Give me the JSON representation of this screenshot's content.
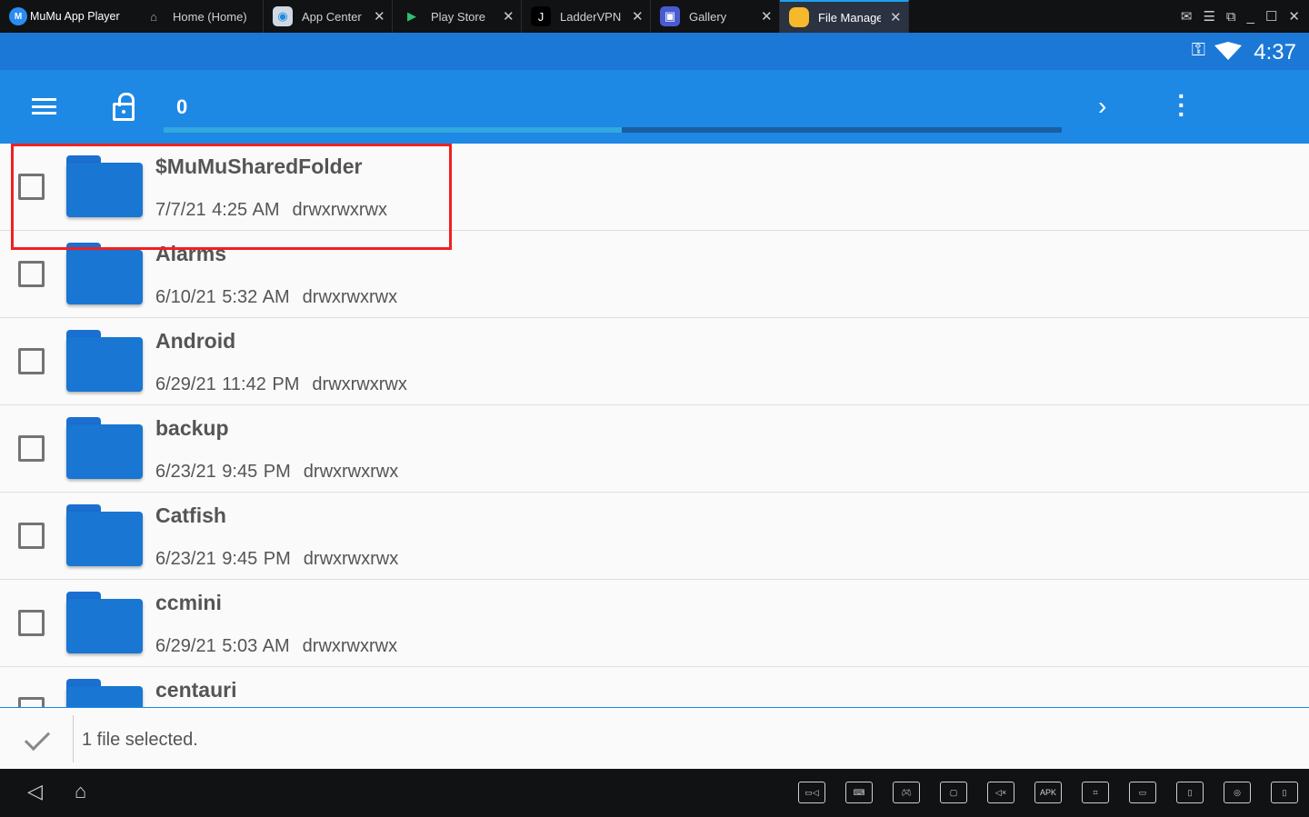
{
  "titlebar": {
    "app_name": "MuMu App Player",
    "tabs": [
      {
        "label": "Home (Home)",
        "icon": "home-icon",
        "closable": false,
        "active": false
      },
      {
        "label": "App Center",
        "icon": "app-center-icon",
        "closable": true,
        "active": false
      },
      {
        "label": "Play Store",
        "icon": "play-store-icon",
        "closable": true,
        "active": false
      },
      {
        "label": "LadderVPN",
        "icon": "laddervpn-icon",
        "closable": true,
        "active": false
      },
      {
        "label": "Gallery",
        "icon": "gallery-icon",
        "closable": true,
        "active": false
      },
      {
        "label": "File Manager",
        "icon": "file-manager-icon",
        "closable": true,
        "active": true
      }
    ]
  },
  "statusbar": {
    "time": "4:37",
    "icons": [
      "vpn-key-icon",
      "wifi-icon"
    ]
  },
  "toolbar": {
    "count": "0",
    "progress_percent": 51,
    "color": "#1e88e5"
  },
  "files": [
    {
      "name": "$MuMuSharedFolder",
      "date": "7/7/21 4:25 AM",
      "perms": "drwxrwxrwx",
      "checked": false,
      "highlighted": true
    },
    {
      "name": "Alarms",
      "date": "6/10/21 5:32 AM",
      "perms": "drwxrwxrwx",
      "checked": false
    },
    {
      "name": "Android",
      "date": "6/29/21 11:42 PM",
      "perms": "drwxrwxrwx",
      "checked": false
    },
    {
      "name": "backup",
      "date": "6/23/21 9:45 PM",
      "perms": "drwxrwxrwx",
      "checked": false
    },
    {
      "name": "Catfish",
      "date": "6/23/21 9:45 PM",
      "perms": "drwxrwxrwx",
      "checked": false
    },
    {
      "name": "ccmini",
      "date": "6/29/21 5:03 AM",
      "perms": "drwxrwxrwx",
      "checked": false
    },
    {
      "name": "centauri",
      "date": "",
      "perms": "",
      "checked": false
    }
  ],
  "footer": {
    "selection_text": "1 file selected."
  },
  "navbar": {
    "tools": [
      "video-record-icon",
      "keyboard-icon",
      "gamepad-icon",
      "screenshot-icon",
      "mute-icon",
      "apk-install-icon",
      "crop-icon",
      "folder-icon",
      "shake-icon",
      "location-icon",
      "multi-window-icon"
    ],
    "apk_label": "APK"
  }
}
